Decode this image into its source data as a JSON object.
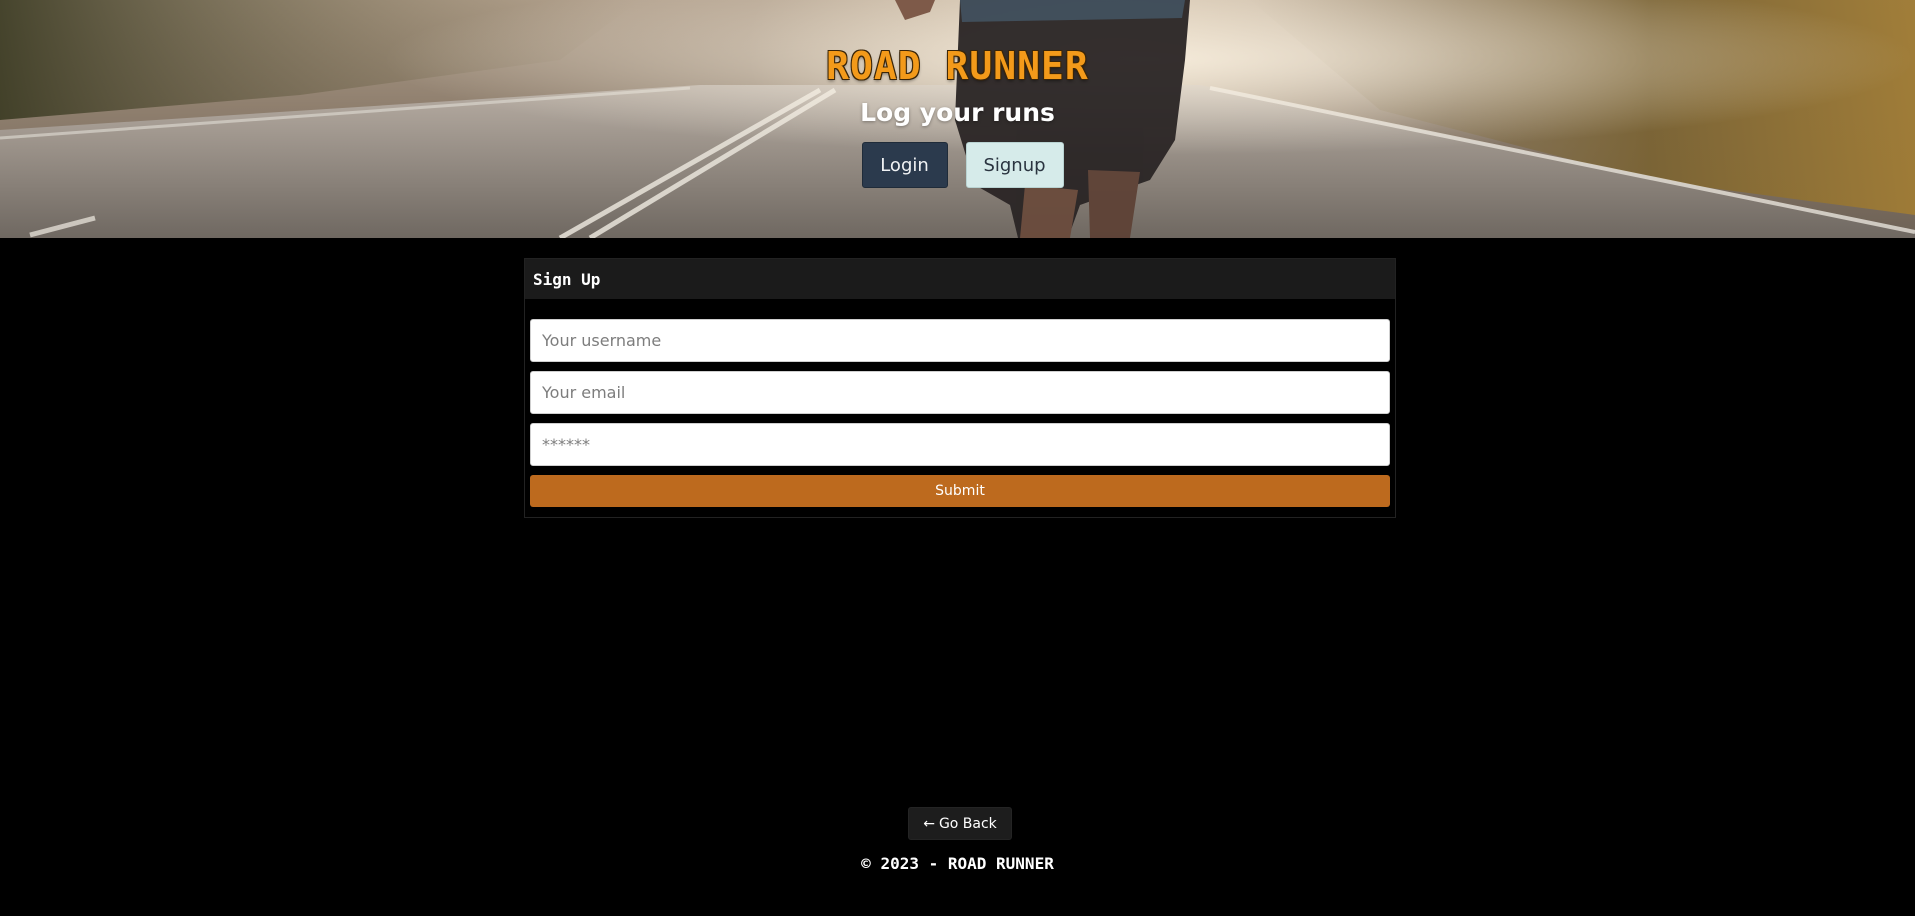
{
  "hero": {
    "title": "ROAD RUNNER",
    "subtitle": "Log your runs",
    "login_label": "Login",
    "signup_label": "Signup",
    "image": "runner-on-road-photo"
  },
  "signup_form": {
    "header": "Sign Up",
    "username": {
      "value": "",
      "placeholder": "Your username"
    },
    "email": {
      "value": "",
      "placeholder": "Your email"
    },
    "password": {
      "value": "",
      "placeholder": "******"
    },
    "submit_label": "Submit"
  },
  "footer": {
    "back_arrow": "←",
    "back_label": "Go Back",
    "copyright": "© 2023 - ROAD RUNNER"
  },
  "colors": {
    "title_orange": "#f39a1a",
    "login_bg": "#2b3a4d",
    "signup_bg": "#d6ebea",
    "submit_bg": "#bd6a1e",
    "page_bg": "#000000"
  }
}
